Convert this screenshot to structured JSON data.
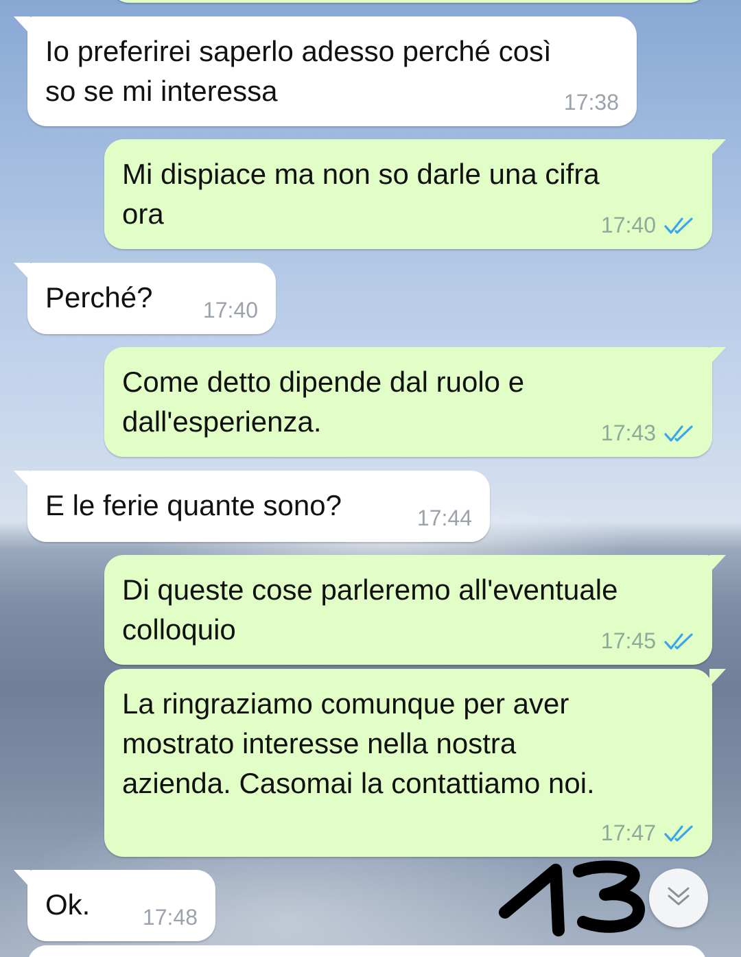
{
  "messages": [
    {
      "text": "Io preferirei saperlo adesso perché così\nso se mi interessa",
      "time": "17:38",
      "direction": "incoming"
    },
    {
      "text": "Mi dispiace ma non so darle una cifra\nora",
      "time": "17:40",
      "direction": "outgoing",
      "status": "read"
    },
    {
      "text": "Perché?",
      "time": "17:40",
      "direction": "incoming"
    },
    {
      "text": "Come detto dipende dal ruolo e\ndall'esperienza.",
      "time": "17:43",
      "direction": "outgoing",
      "status": "read"
    },
    {
      "text": "E le ferie quante sono?",
      "time": "17:44",
      "direction": "incoming"
    },
    {
      "text": "Di queste cose parleremo all'eventuale\ncolloquio",
      "time": "17:45",
      "direction": "outgoing",
      "status": "read"
    },
    {
      "text": "La ringraziamo comunque per aver\nmostrato interesse nella nostra\nazienda. Casomai la contattiamo noi.",
      "time": "17:47",
      "direction": "outgoing",
      "status": "read"
    },
    {
      "text": "Ok.",
      "time": "17:48",
      "direction": "incoming"
    }
  ],
  "annotation": "13",
  "colors": {
    "incoming_bubble": "#ffffff",
    "outgoing_bubble": "#e1fec6",
    "read_ticks": "#3aa5e8",
    "timestamp": "#9aa3ab"
  },
  "icons": {
    "read_receipt": "double-check-icon",
    "scroll_down": "double-chevron-down-icon"
  }
}
